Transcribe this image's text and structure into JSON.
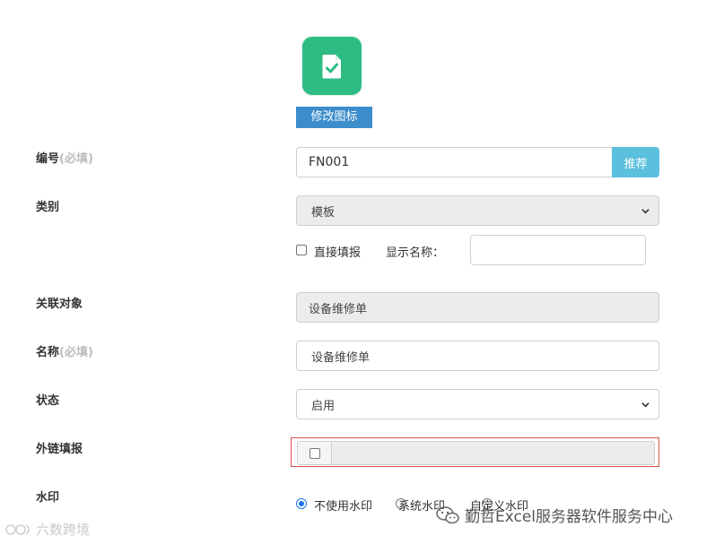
{
  "icon_section": {
    "change_icon_label": "修改图标",
    "icon_name": "document-check-icon",
    "icon_color": "#2fbc84"
  },
  "form": {
    "code": {
      "label": "编号",
      "required": "(必填)",
      "value": "FN001",
      "recommend_label": "推荐"
    },
    "category": {
      "label": "类别",
      "selected": "模板",
      "direct_fill_label": "直接填报",
      "display_name_label": "显示名称：",
      "display_name_value": ""
    },
    "related": {
      "label": "关联对象",
      "value": "设备维修单"
    },
    "name": {
      "label": "名称",
      "required": "(必填)",
      "value": "设备维修单"
    },
    "status": {
      "label": "状态",
      "selected": "启用"
    },
    "external": {
      "label": "外链填报",
      "value": ""
    },
    "watermark": {
      "label": "水印",
      "options": [
        {
          "label": "不使用水印",
          "checked": true
        },
        {
          "label": "系统水印",
          "checked": false
        },
        {
          "label": "自定义水印",
          "checked": false
        }
      ]
    }
  },
  "overlays": {
    "left_watermark": "六数跨境",
    "right_watermark": "勤哲Excel服务器软件服务中心",
    "highlight_color": "#d9534f"
  }
}
